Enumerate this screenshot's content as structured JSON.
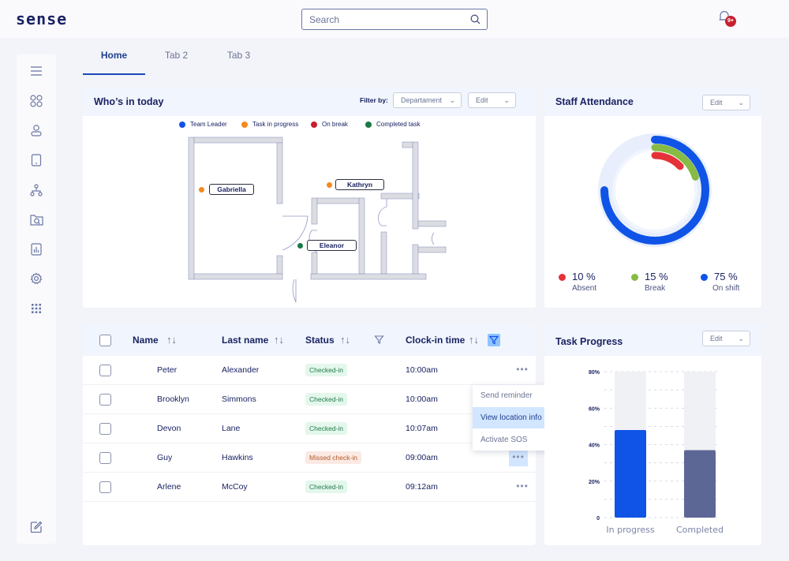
{
  "app": {
    "logo": "sense"
  },
  "search": {
    "placeholder": "Search"
  },
  "notifications": {
    "badge": "9+"
  },
  "sidebar": {
    "items": [
      "menu-icon",
      "dashboard-icon",
      "user-icon",
      "tablet-icon",
      "hierarchy-icon",
      "folder-search-icon",
      "report-icon",
      "settings-icon",
      "apps-icon",
      "edit-icon"
    ]
  },
  "tabs": [
    {
      "label": "Home",
      "active": true
    },
    {
      "label": "Tab 2"
    },
    {
      "label": "Tab 3"
    }
  ],
  "whos_in": {
    "title": "Who’s in today",
    "filter_label": "Filter by:",
    "filter_value": "Departament",
    "edit_label": "Edit",
    "legend": [
      {
        "label": "Team Leader",
        "color": "#1152e8"
      },
      {
        "label": "Task in progress",
        "color": "#f28a1c"
      },
      {
        "label": "On break",
        "color": "#c8202f"
      },
      {
        "label": "Completed task",
        "color": "#1a7a44"
      }
    ],
    "people": [
      {
        "name": "Gabriella",
        "status": "Task in progress",
        "color": "#f28a1c"
      },
      {
        "name": "Kathryn",
        "status": "Task in progress",
        "color": "#f28a1c"
      },
      {
        "name": "Eleanor",
        "status": "Completed task",
        "color": "#1a7a44"
      }
    ]
  },
  "attendance": {
    "title": "Staff Attendance",
    "edit_label": "Edit",
    "stats": [
      {
        "value": "10 %",
        "label": "Absent",
        "color": "#e53238"
      },
      {
        "value": "15 %",
        "label": "Break",
        "color": "#86bb44"
      },
      {
        "value": "75 %",
        "label": "On shift",
        "color": "#0f54e6"
      }
    ]
  },
  "table": {
    "headers": {
      "name": "Name",
      "last_name": "Last name",
      "status": "Status",
      "clock_in": "Clock-in time"
    },
    "rows": [
      {
        "name": "Peter",
        "last_name": "Alexander",
        "status": "Checked-in",
        "clock_in": "10:00am"
      },
      {
        "name": "Brooklyn",
        "last_name": "Simmons",
        "status": "Checked-in",
        "clock_in": "10:00am"
      },
      {
        "name": "Devon",
        "last_name": "Lane",
        "status": "Checked-in",
        "clock_in": "10:07am"
      },
      {
        "name": "Guy",
        "last_name": "Hawkins",
        "status": "Missed check-in",
        "clock_in": "09:00am"
      },
      {
        "name": "Arlene",
        "last_name": "McCoy",
        "status": "Checked-in",
        "clock_in": "09:12am"
      }
    ],
    "more_label": "•••",
    "context_menu": [
      "Send reminder",
      "View location info",
      "Activate SOS"
    ]
  },
  "task_progress": {
    "title": "Task Progress",
    "edit_label": "Edit"
  },
  "chart_data": [
    {
      "type": "pie",
      "title": "Staff Attendance",
      "categories": [
        "Absent",
        "Break",
        "On shift"
      ],
      "values": [
        10,
        15,
        75
      ],
      "colors": [
        "#e53238",
        "#86bb44",
        "#0f54e6"
      ]
    },
    {
      "type": "bar",
      "title": "Task Progress",
      "categories": [
        "In progress",
        "Completed"
      ],
      "values": [
        48,
        37
      ],
      "tick_labels": [
        "0",
        "20%",
        "40%",
        "60%",
        "80%"
      ],
      "ylim": [
        0,
        80
      ],
      "grid": true,
      "colors": [
        "#0f54e6",
        "#5c6796"
      ]
    }
  ]
}
